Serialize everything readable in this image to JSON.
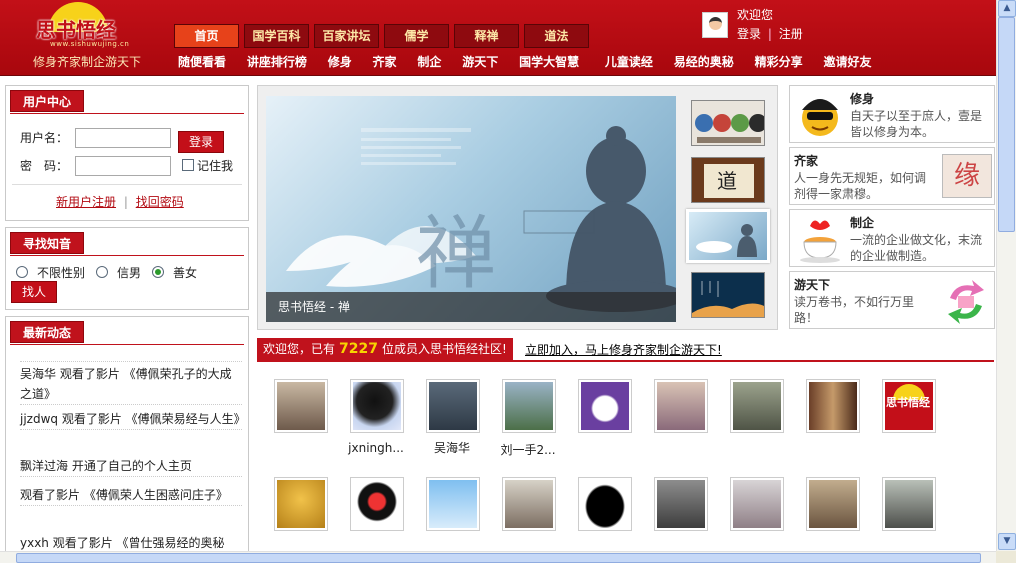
{
  "header": {
    "logo_text": "思书悟经",
    "logo_url_text": "www.sishuwujing.cn",
    "slogan": "修身齐家制企游天下",
    "tabs": [
      "首页",
      "国学百科",
      "百家讲坛",
      "儒学",
      "释禅",
      "道法"
    ],
    "subnav": [
      "随便看看",
      "讲座排行榜",
      "修身",
      "齐家",
      "制企",
      "游天下",
      "国学大智慧",
      "儿童读经",
      "易经的奥秘",
      "精彩分享",
      "邀请好友"
    ],
    "welcome": "欢迎您",
    "login": "登录",
    "separator": "|",
    "register": "注册"
  },
  "user_center": {
    "title": "用户中心",
    "username_label": "用户名：",
    "password_label": "密　码：",
    "login_button": "登录",
    "remember": "记住我",
    "register_link": "新用户注册",
    "separator": "|",
    "forgot_link": "找回密码"
  },
  "find_friend": {
    "title": "寻找知音",
    "options": [
      "不限性别",
      "信男",
      "善女"
    ],
    "selected": "善女",
    "button": "找人"
  },
  "news": {
    "title": "最新动态",
    "items": [
      "吴海华 观看了影片 《傅佩荣孔子的大成之道》",
      "jjzdwq 观看了影片 《傅佩荣易经与人生》",
      "飘洋过海 开通了自己的个人主页",
      "观看了影片 《傅佩荣人生困惑问庄子》",
      "yxxh 观看了影片 《曾仕强易经的奥秘"
    ]
  },
  "slideshow": {
    "caption": "思书悟经 - 禅",
    "main_char": "禅",
    "thumb_logo": "思书悟经"
  },
  "features": [
    {
      "title": "修身",
      "desc": "自天子以至于庶人，壹是皆以修身为本。"
    },
    {
      "title": "齐家",
      "desc": "人一身先无规矩，如何调剂得一家肃穆。",
      "badge": "缘"
    },
    {
      "title": "制企",
      "desc": "一流的企业做文化，末流的企业做制造。"
    },
    {
      "title": "游天下",
      "desc": "读万卷书，不如行万里路！"
    }
  ],
  "community": {
    "prefix": "欢迎您，已有",
    "count": "7227",
    "suffix": "位成员入思书悟经社区!",
    "join": "立即加入，马上修身齐家制企游天下!"
  },
  "members_row1": [
    "",
    "jxningh...",
    "吴海华",
    "刘一手2...",
    "",
    "",
    "",
    "",
    "思书悟经"
  ],
  "members_row2": [
    "",
    "",
    "",
    "",
    "",
    "",
    "",
    "",
    ""
  ],
  "colors": {
    "brand_red": "#c0121c",
    "header_red": "#b00b12",
    "active_tab": "#e7421a",
    "count_yellow": "#f8d400"
  }
}
